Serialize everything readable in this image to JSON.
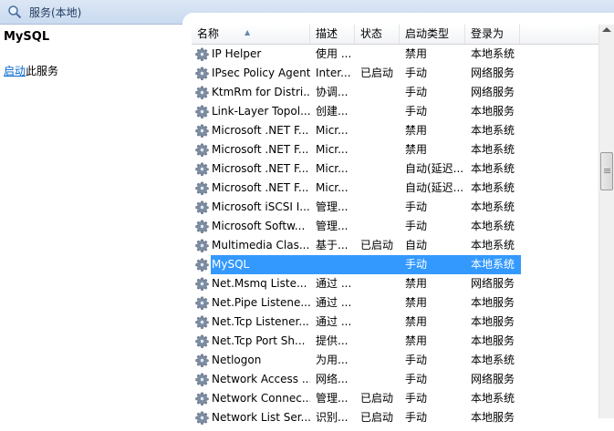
{
  "window": {
    "title": "服务(本地)"
  },
  "left_panel": {
    "service_name": "MySQL",
    "start_link": "启动",
    "start_suffix": "此服务"
  },
  "columns": [
    "名称",
    "描述",
    "状态",
    "启动类型",
    "登录为"
  ],
  "rows": [
    {
      "name": "IP Helper",
      "desc": "使用 ...",
      "status": "",
      "startup": "禁用",
      "logon": "本地系统"
    },
    {
      "name": "IPsec Policy Agent",
      "desc": "Inter...",
      "status": "已启动",
      "startup": "手动",
      "logon": "网络服务"
    },
    {
      "name": "KtmRm for Distri...",
      "desc": "协调...",
      "status": "",
      "startup": "手动",
      "logon": "网络服务"
    },
    {
      "name": "Link-Layer Topol...",
      "desc": "创建...",
      "status": "",
      "startup": "手动",
      "logon": "本地服务"
    },
    {
      "name": "Microsoft .NET F...",
      "desc": "Micr...",
      "status": "",
      "startup": "禁用",
      "logon": "本地系统"
    },
    {
      "name": "Microsoft .NET F...",
      "desc": "Micr...",
      "status": "",
      "startup": "禁用",
      "logon": "本地系统"
    },
    {
      "name": "Microsoft .NET F...",
      "desc": "Micr...",
      "status": "",
      "startup": "自动(延迟...",
      "logon": "本地系统"
    },
    {
      "name": "Microsoft .NET F...",
      "desc": "Micr...",
      "status": "",
      "startup": "自动(延迟...",
      "logon": "本地系统"
    },
    {
      "name": "Microsoft iSCSI I...",
      "desc": "管理...",
      "status": "",
      "startup": "手动",
      "logon": "本地系统"
    },
    {
      "name": "Microsoft Softw...",
      "desc": "管理...",
      "status": "",
      "startup": "手动",
      "logon": "本地系统"
    },
    {
      "name": "Multimedia Clas...",
      "desc": "基于...",
      "status": "已启动",
      "startup": "自动",
      "logon": "本地系统"
    },
    {
      "name": "MySQL",
      "desc": "",
      "status": "",
      "startup": "手动",
      "logon": "本地系统",
      "selected": true
    },
    {
      "name": "Net.Msmq Liste...",
      "desc": "通过 ...",
      "status": "",
      "startup": "禁用",
      "logon": "网络服务"
    },
    {
      "name": "Net.Pipe Listene...",
      "desc": "通过 ...",
      "status": "",
      "startup": "禁用",
      "logon": "本地服务"
    },
    {
      "name": "Net.Tcp Listener...",
      "desc": "通过 ...",
      "status": "",
      "startup": "禁用",
      "logon": "本地服务"
    },
    {
      "name": "Net.Tcp Port Sh...",
      "desc": "提供...",
      "status": "",
      "startup": "禁用",
      "logon": "本地服务"
    },
    {
      "name": "Netlogon",
      "desc": "为用...",
      "status": "",
      "startup": "手动",
      "logon": "本地系统"
    },
    {
      "name": "Network Access ...",
      "desc": "网络...",
      "status": "",
      "startup": "手动",
      "logon": "网络服务"
    },
    {
      "name": "Network Connec...",
      "desc": "管理...",
      "status": "已启动",
      "startup": "手动",
      "logon": "本地系统"
    },
    {
      "name": "Network List Ser...",
      "desc": "识别...",
      "status": "已启动",
      "startup": "手动",
      "logon": "本地服务"
    }
  ],
  "icons": {
    "title": "magnifier-icon",
    "row": "gear-icon"
  },
  "colors": {
    "selection": "#3399ff",
    "link": "#0066cc",
    "titlebar": "#c9daf0"
  }
}
